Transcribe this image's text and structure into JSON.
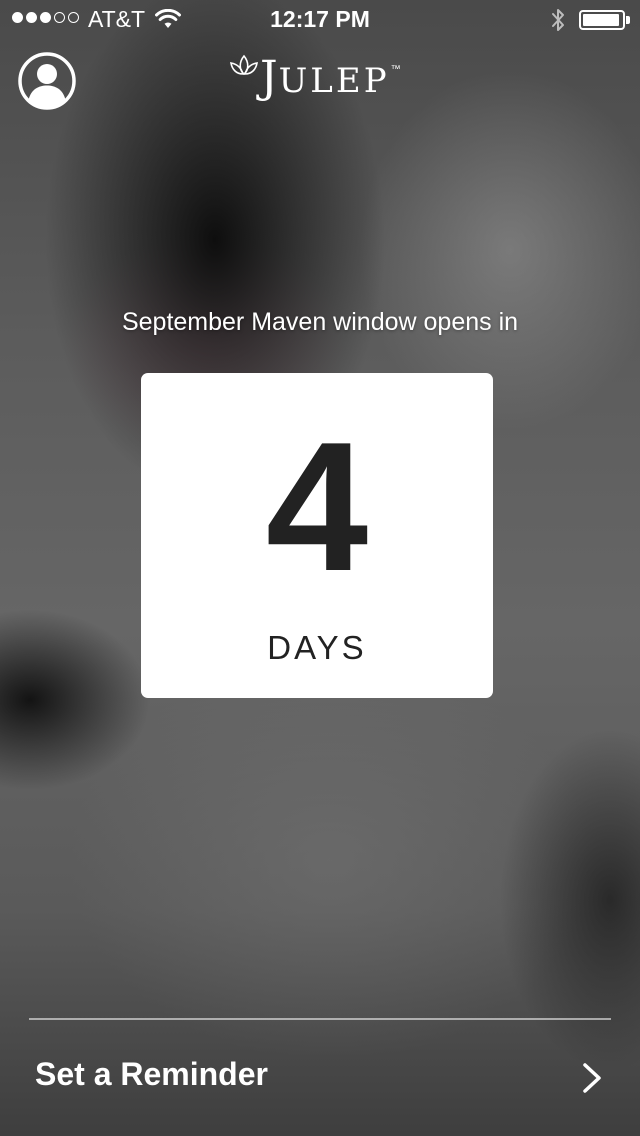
{
  "status_bar": {
    "signal_bars_filled": 3,
    "signal_bars_total": 5,
    "carrier": "AT&T",
    "time": "12:17 PM",
    "battery_level": 0.95
  },
  "header": {
    "profile_icon": "user-circle-icon",
    "logo_text_initial": "J",
    "logo_text_rest": "ULEP",
    "logo_tm": "™"
  },
  "countdown": {
    "label": "September Maven window opens in",
    "value": "4",
    "unit": "DAYS"
  },
  "reminder": {
    "label": "Set a Reminder",
    "icon": "chevron-right-icon"
  },
  "colors": {
    "card_background": "#ffffff",
    "countdown_text": "#222222",
    "foreground": "#ffffff"
  }
}
